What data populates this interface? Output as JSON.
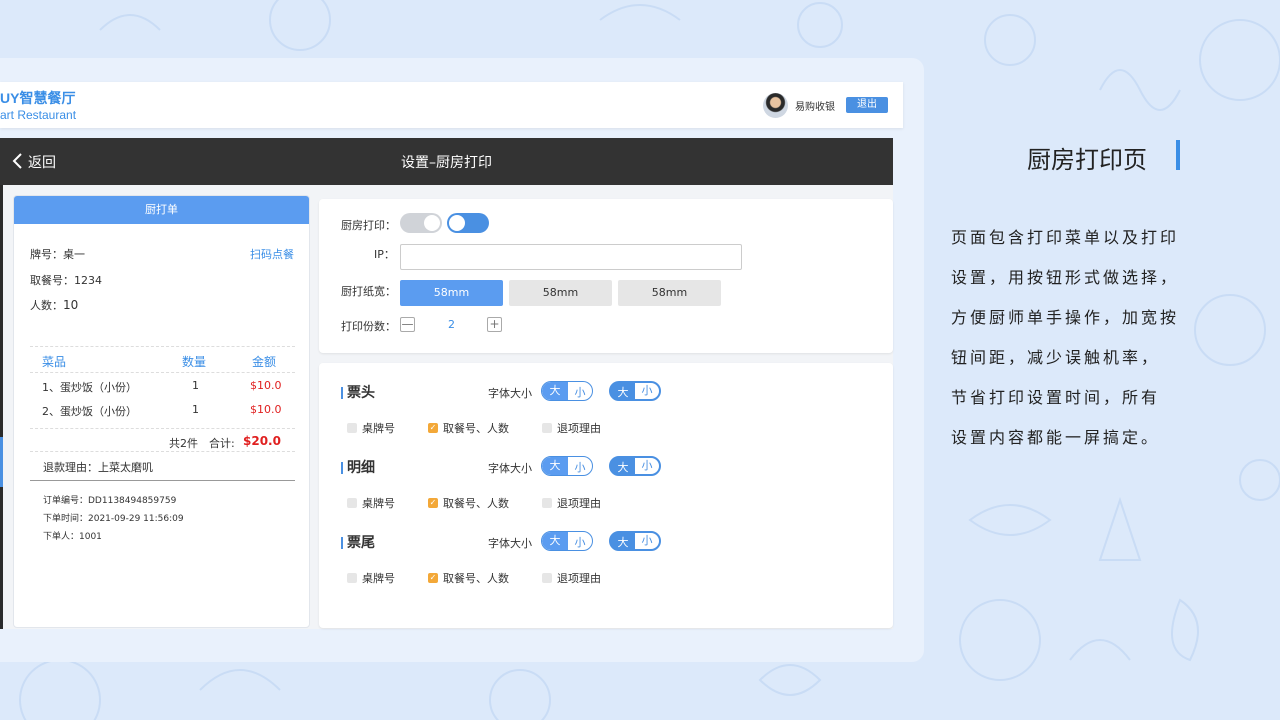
{
  "header": {
    "brand_cn": "UY智慧餐厅",
    "brand_en": "art Restaurant",
    "cashier_name": "易购收银",
    "logout_label": "退出"
  },
  "navbar": {
    "back_label": "返回",
    "title": "设置–厨房打印"
  },
  "receipt": {
    "head": "厨打单",
    "table_no": "牌号：桌一",
    "scan_link": "扫码点餐",
    "pickup_no": "取餐号：1234",
    "people_label": "人数：",
    "people_value": "10",
    "columns": [
      "菜品",
      "数量",
      "金额"
    ],
    "items": [
      {
        "name": "1、蛋炒饭（小份）",
        "qty": "1",
        "price": "$10.0"
      },
      {
        "name": "2、蛋炒饭（小份）",
        "qty": "1",
        "price": "$10.0"
      }
    ],
    "count_text": "共2件",
    "total_label": "合计:",
    "total_value": "$20.0",
    "refund_reason": "退款理由：上菜太磨叽",
    "order_no": "订单编号：DD1138494859759",
    "order_time": "下单时间：2021-09-29 11:56:09",
    "order_user": "下单人：1001"
  },
  "settings": {
    "kitchen_print_label": "厨房打印：",
    "ip_label": "IP：",
    "paper_label": "厨打纸宽：",
    "paper_options": [
      "58mm",
      "58mm",
      "58mm"
    ],
    "copies_label": "打印份数：",
    "copies_value": "2",
    "minus": "—",
    "plus": "+"
  },
  "sections": [
    {
      "title": "票头",
      "font_label": "字体大小",
      "big": "大",
      "small": "小",
      "checks": [
        "桌牌号",
        "取餐号、人数",
        "退项理由"
      ]
    },
    {
      "title": "明细",
      "font_label": "字体大小",
      "big": "大",
      "small": "小",
      "checks": [
        "桌牌号",
        "取餐号、人数",
        "退项理由"
      ]
    },
    {
      "title": "票尾",
      "font_label": "字体大小",
      "big": "大",
      "small": "小",
      "checks": [
        "桌牌号",
        "取餐号、人数",
        "退项理由"
      ]
    }
  ],
  "description": {
    "title": "厨房打印页",
    "lines": [
      "页面包含打印菜单以及打印",
      "设置，用按钮形式做选择，",
      "方便厨师单手操作，加宽按",
      "钮间距，减少误触机率，",
      "节省打印设置时间，所有",
      "设置内容都能一屏搞定。"
    ]
  },
  "colors": {
    "accent": "#4a90e2",
    "price": "#e02020",
    "checked": "#f3a838",
    "background": "#dce9fa"
  }
}
